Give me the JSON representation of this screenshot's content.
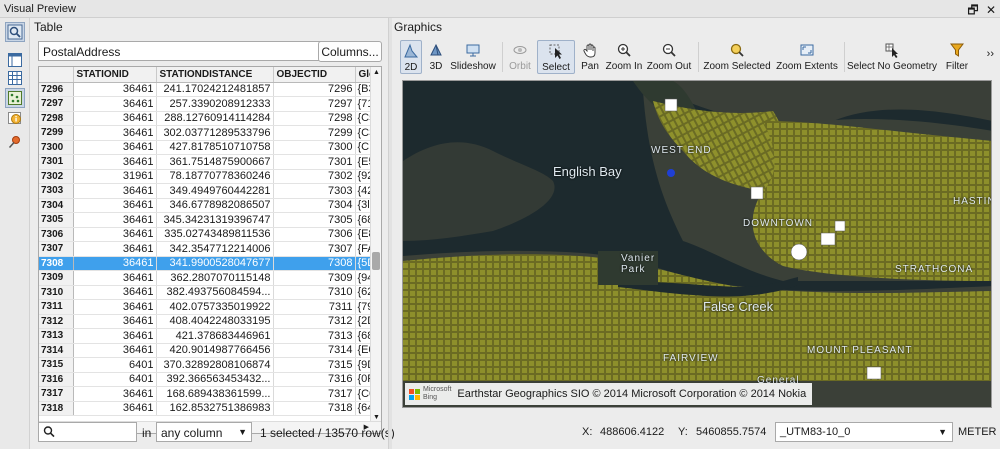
{
  "window": {
    "title": "Visual Preview",
    "restore_glyph": "🗗",
    "close_glyph": "✕"
  },
  "left_tools": [
    {
      "name": "identify-tool",
      "icon": "identify-icon"
    },
    {
      "name": "layout-tool",
      "icon": "panel-icon"
    },
    {
      "name": "table-tool",
      "icon": "grid-icon"
    },
    {
      "name": "graphics-tool",
      "icon": "map-icon"
    },
    {
      "name": "info-tool",
      "icon": "info-icon"
    },
    {
      "name": "pin-tool",
      "icon": "pushpin-icon"
    }
  ],
  "table": {
    "label": "Table",
    "layer": "PostalAddress",
    "columns_button": "Columns...",
    "headers": [
      "",
      "STATIONID",
      "STATIONDISTANCE",
      "OBJECTID",
      "Glo"
    ],
    "rows": [
      [
        "7296",
        "36461",
        "241.17024212481857",
        "7296",
        "{B3"
      ],
      [
        "7297",
        "36461",
        "257.3390208912333",
        "7297",
        "{71"
      ],
      [
        "7298",
        "36461",
        "288.12760914114284",
        "7298",
        "{C5"
      ],
      [
        "7299",
        "36461",
        "302.03771289533796",
        "7299",
        "{C3"
      ],
      [
        "7300",
        "36461",
        "427.8178510710758",
        "7300",
        "{CI"
      ],
      [
        "7301",
        "36461",
        "361.7514875900667",
        "7301",
        "{E5"
      ],
      [
        "7302",
        "31961",
        "78.18770778360246",
        "7302",
        "{92"
      ],
      [
        "7303",
        "36461",
        "349.4949760442281",
        "7303",
        "{42"
      ],
      [
        "7304",
        "36461",
        "346.6778982086507",
        "7304",
        "{3l"
      ],
      [
        "7305",
        "36461",
        "345.34231319396747",
        "7305",
        "{68"
      ],
      [
        "7306",
        "36461",
        "335.02743489811536",
        "7306",
        "{E8"
      ],
      [
        "7307",
        "36461",
        "342.3547712214006",
        "7307",
        "{FA"
      ],
      [
        "7308",
        "36461",
        "341.9900528047677",
        "7308",
        "{5D"
      ],
      [
        "7309",
        "36461",
        "362.2807070115148",
        "7309",
        "{94"
      ],
      [
        "7310",
        "36461",
        "382.493756084594...",
        "7310",
        "{62"
      ],
      [
        "7311",
        "36461",
        "402.0757335019922",
        "7311",
        "{79"
      ],
      [
        "7312",
        "36461",
        "408.4042248033195",
        "7312",
        "{2D"
      ],
      [
        "7313",
        "36461",
        "421.378683446961",
        "7313",
        "{68"
      ],
      [
        "7314",
        "36461",
        "420.9014987766456",
        "7314",
        "{E0"
      ],
      [
        "7315",
        "6401",
        "370.32892808106874",
        "7315",
        "{9D"
      ],
      [
        "7316",
        "6401",
        "392.366563453432...",
        "7316",
        "{0F"
      ],
      [
        "7317",
        "36461",
        "168.689438361599...",
        "7317",
        "{C0"
      ],
      [
        "7318",
        "36461",
        "162.8532751386983",
        "7318",
        "{64"
      ]
    ],
    "selected_row": 12,
    "search_placeholder": "",
    "in_label": "in",
    "column_filter": "any column",
    "status": "1 selected / 13570 row(s)"
  },
  "graphics": {
    "label": "Graphics",
    "toolbar": [
      {
        "id": "2d",
        "label": "2D",
        "icon": "2d-view-icon",
        "active": true,
        "disabled": false
      },
      {
        "id": "3d",
        "label": "3D",
        "icon": "3d-view-icon",
        "active": false,
        "disabled": false
      },
      {
        "id": "slideshow",
        "label": "Slideshow",
        "icon": "slideshow-icon",
        "active": false,
        "disabled": false
      },
      {
        "id": "orbit",
        "label": "Orbit",
        "icon": "orbit-icon",
        "active": false,
        "disabled": true
      },
      {
        "id": "select",
        "label": "Select",
        "icon": "cursor-icon",
        "active": true,
        "disabled": false
      },
      {
        "id": "pan",
        "label": "Pan",
        "icon": "hand-icon",
        "active": false,
        "disabled": false
      },
      {
        "id": "zoom-in",
        "label": "Zoom In",
        "icon": "zoom-in-icon",
        "active": false,
        "disabled": false
      },
      {
        "id": "zoom-out",
        "label": "Zoom Out",
        "icon": "zoom-out-icon",
        "active": false,
        "disabled": false
      },
      {
        "id": "zoom-selected",
        "label": "Zoom Selected",
        "icon": "zoom-selected-icon",
        "active": false,
        "disabled": false
      },
      {
        "id": "zoom-extents",
        "label": "Zoom Extents",
        "icon": "zoom-extents-icon",
        "active": false,
        "disabled": false
      },
      {
        "id": "select-no-geometry",
        "label": "Select No Geometry",
        "icon": "select-no-geometry-icon",
        "active": false,
        "disabled": false
      },
      {
        "id": "filter",
        "label": "Filter",
        "icon": "funnel-icon",
        "active": false,
        "disabled": false
      }
    ],
    "overflow_glyph": "››",
    "map_labels": {
      "english_bay": "English Bay",
      "west_end": "WEST END",
      "downtown": "DOWNTOWN",
      "hastings": "HASTING",
      "vanier_park": "Vanier\nPark",
      "false_creek": "False Creek",
      "strathcona": "STRATHCONA",
      "fairview": "FAIRVIEW",
      "mount_pleasant": "MOUNT PLEASANT",
      "general": "General"
    },
    "attribution": {
      "logo_line1": "Microsoft",
      "logo_line2": "Bing",
      "text": "Earthstar Geographics SIO © 2014 Microsoft Corporation © 2014 Nokia"
    },
    "status": {
      "x_label": "X:",
      "x_value": "488606.4122",
      "y_label": "Y:",
      "y_value": "5460855.7574",
      "projection": "_UTM83-10_0",
      "unit": "METER"
    },
    "colors": {
      "water": "#1e2a2e",
      "land": "#3a3f37",
      "address_points": "#8a8c2a",
      "selected_point": "#1f3fd4",
      "selection_blue": "#3fa0ec"
    }
  }
}
